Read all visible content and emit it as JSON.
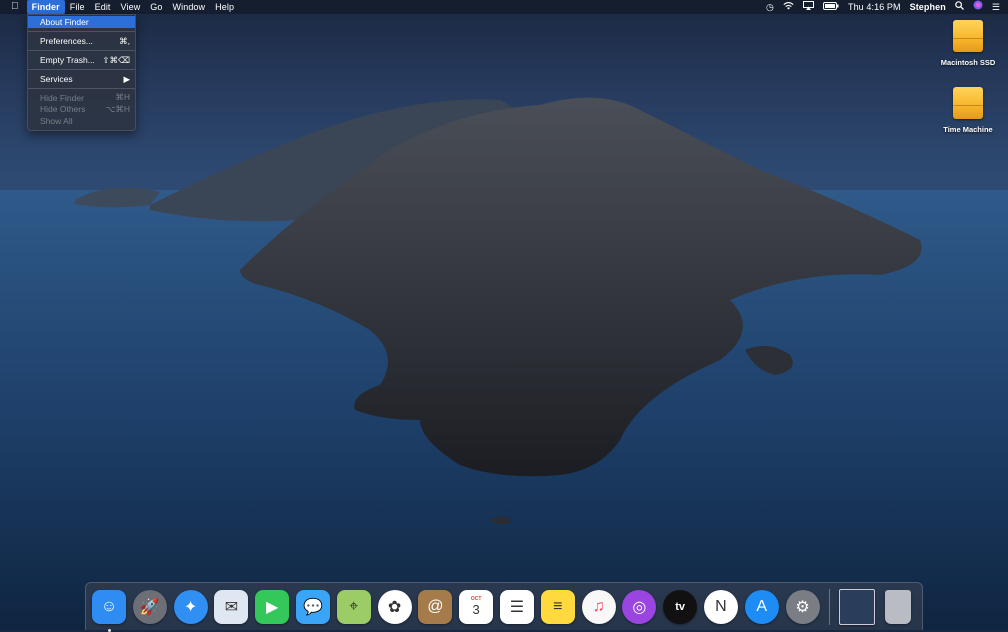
{
  "menubar": {
    "apple_icon": "apple-logo",
    "app_name": "Finder",
    "menus": [
      "File",
      "Edit",
      "View",
      "Go",
      "Window",
      "Help"
    ],
    "status": {
      "time_machine_icon": "clock-arrow",
      "wifi_icon": "wifi",
      "airplay_icon": "airplay",
      "battery_icon": "battery",
      "clock": "Thu 4:16 PM",
      "user": "Stephen",
      "spotlight_icon": "magnifier",
      "siri_icon": "siri",
      "notification_icon": "list"
    }
  },
  "finder_menu": {
    "about": "About Finder",
    "preferences": "Preferences...",
    "preferences_shortcut": "⌘,",
    "empty_trash": "Empty Trash...",
    "empty_trash_shortcut": "⇧⌘⌫",
    "services": "Services",
    "services_arrow": "▶",
    "hide_finder": "Hide Finder",
    "hide_finder_shortcut": "⌘H",
    "hide_others": "Hide Others",
    "hide_others_shortcut": "⌥⌘H",
    "show_all": "Show All"
  },
  "desktop": {
    "disks": [
      {
        "label": "Macintosh SSD"
      },
      {
        "label": "Time Machine"
      }
    ]
  },
  "dock": {
    "apps": [
      {
        "name": "finder",
        "color": "#2f8cf2",
        "glyph": "☺"
      },
      {
        "name": "launchpad",
        "color": "#6d6f76",
        "glyph": "🚀"
      },
      {
        "name": "safari",
        "color": "#2f8ff3",
        "glyph": "✦"
      },
      {
        "name": "mail",
        "color": "#dfe7f2",
        "glyph": "✉"
      },
      {
        "name": "facetime",
        "color": "#34c759",
        "glyph": "▶"
      },
      {
        "name": "messages",
        "color": "#3aa4f6",
        "glyph": "💬"
      },
      {
        "name": "maps",
        "color": "#9ccc65",
        "glyph": "⌖"
      },
      {
        "name": "photos",
        "color": "#ffffff",
        "glyph": "✿"
      },
      {
        "name": "contacts",
        "color": "#a67b4a",
        "glyph": "@"
      },
      {
        "name": "calendar",
        "color": "#ffffff",
        "glyph": "3",
        "month": "OCT"
      },
      {
        "name": "reminders",
        "color": "#ffffff",
        "glyph": "☰"
      },
      {
        "name": "notes",
        "color": "#ffd93d",
        "glyph": "≡"
      },
      {
        "name": "music",
        "color": "#f8f8f8",
        "glyph": "♫"
      },
      {
        "name": "podcasts",
        "color": "#9b45e0",
        "glyph": "◎"
      },
      {
        "name": "tv",
        "color": "#111111",
        "glyph": "tv"
      },
      {
        "name": "news",
        "color": "#ffffff",
        "glyph": "N"
      },
      {
        "name": "app-store",
        "color": "#1d8cf5",
        "glyph": "A"
      },
      {
        "name": "system-preferences",
        "color": "#7a7d84",
        "glyph": "⚙"
      }
    ],
    "others": [
      {
        "name": "desktop-stack",
        "color": "#2a3d5a"
      },
      {
        "name": "trash",
        "color": "#b9bcc2"
      }
    ]
  }
}
